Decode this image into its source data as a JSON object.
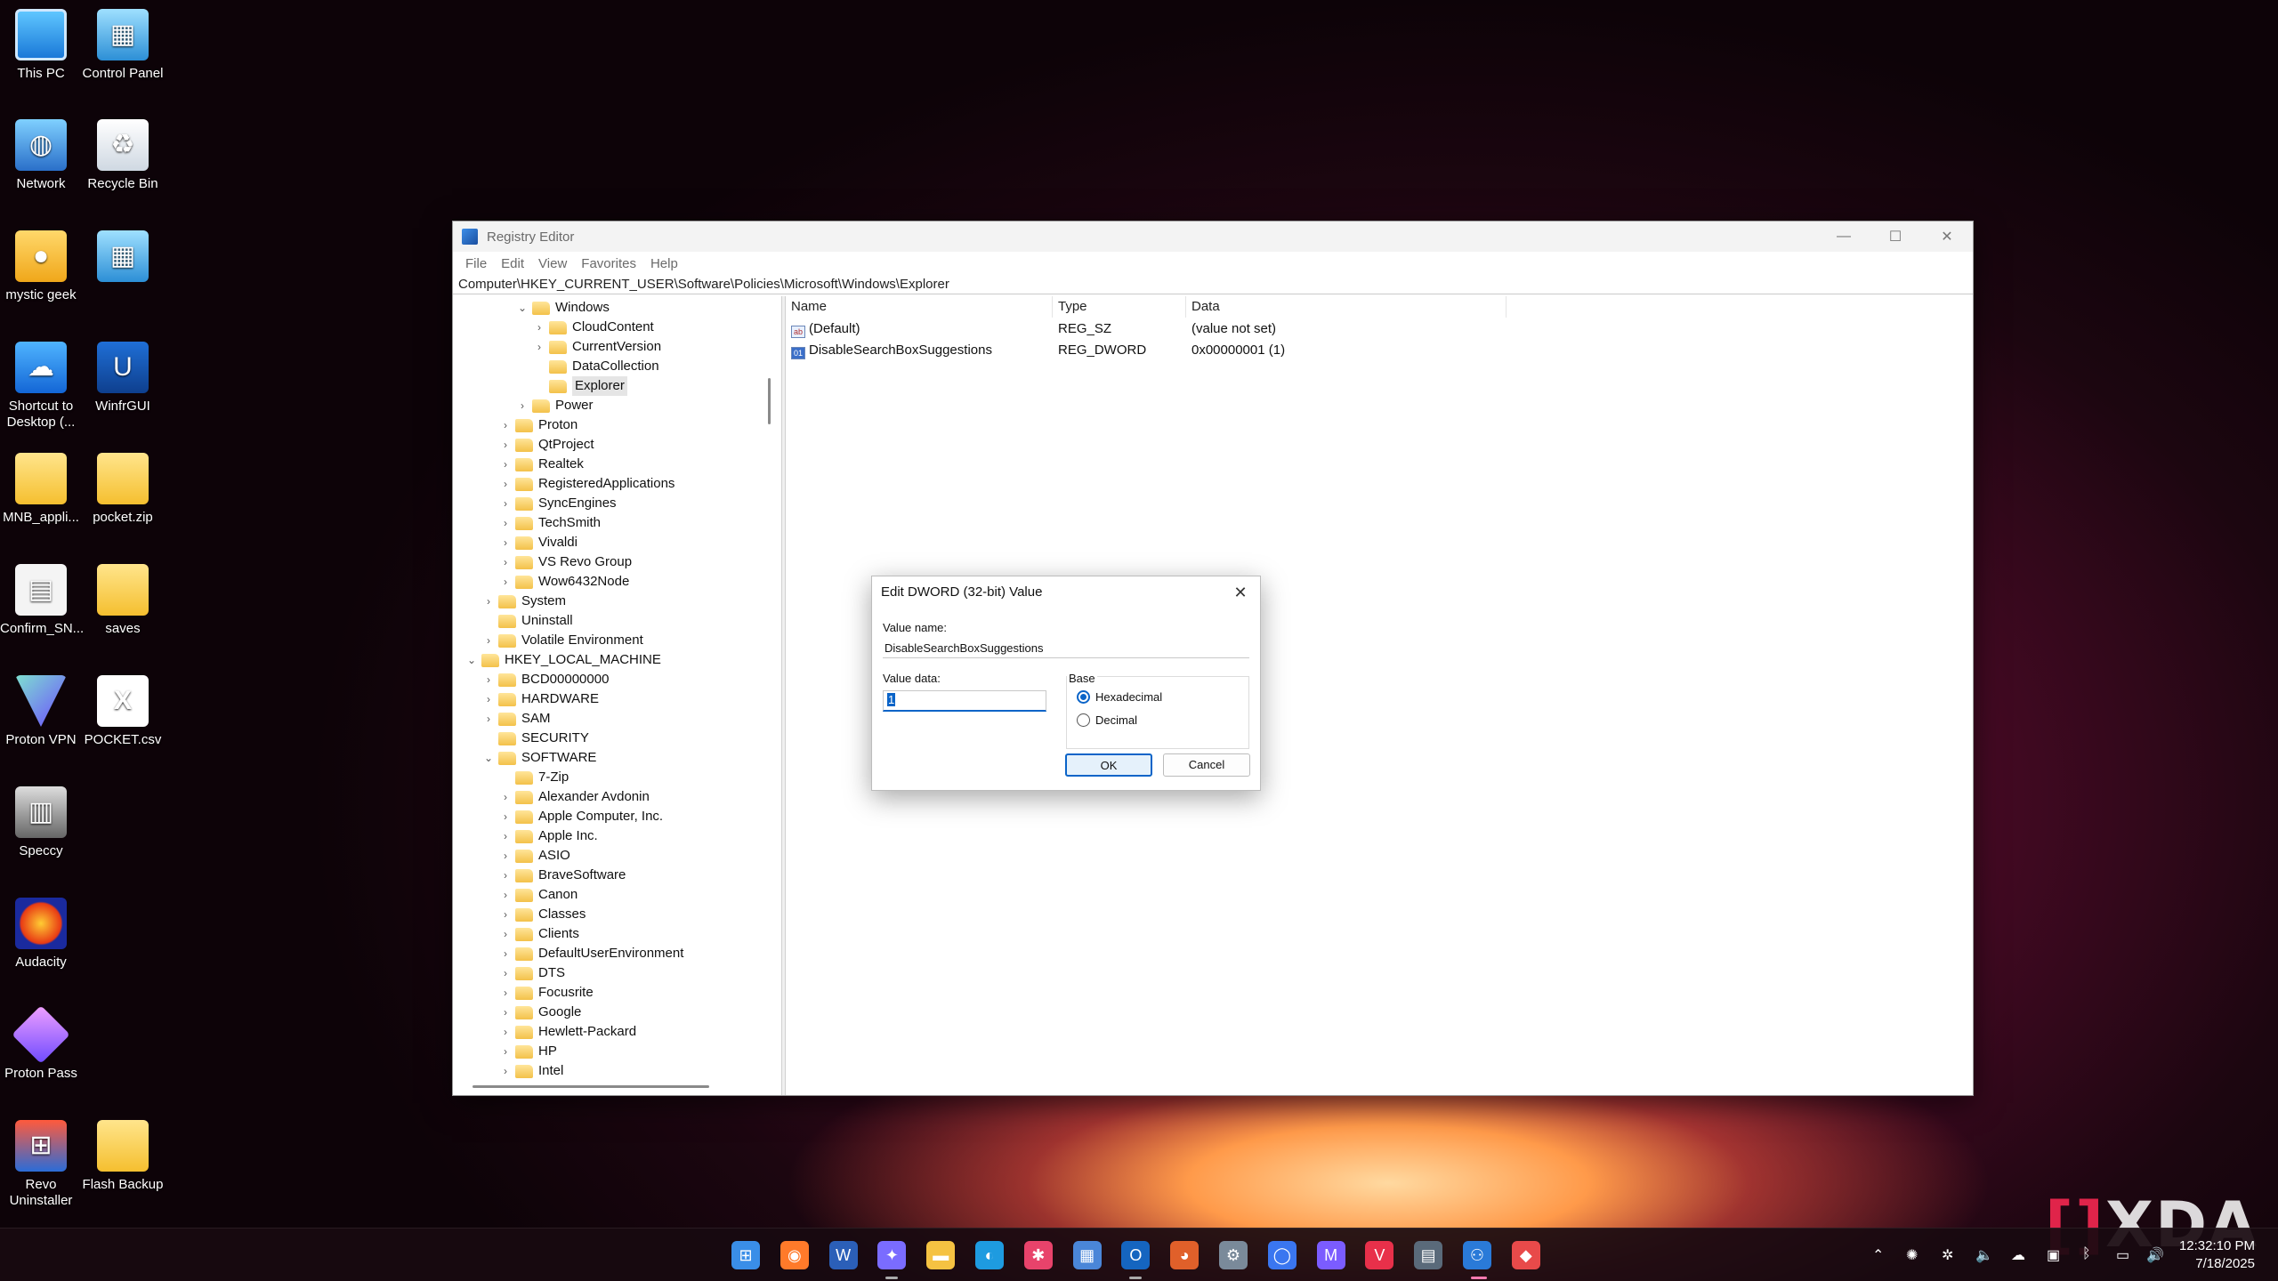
{
  "desktop": {
    "icons": [
      {
        "label": "This PC",
        "icon": "this-pc-icon"
      },
      {
        "label": "Control Panel",
        "icon": "control-panel-icon"
      },
      {
        "label": "Network",
        "icon": "network-icon"
      },
      {
        "label": "Recycle Bin",
        "icon": "recycle-bin-icon"
      },
      {
        "label": "mystic geek",
        "icon": "user-folder-icon"
      },
      {
        "label": "",
        "icon": "control-panel-icon"
      },
      {
        "label": "Shortcut to Desktop (...",
        "icon": "onedrive-icon"
      },
      {
        "label": "WinfrGUI",
        "icon": "winfrgui-icon"
      },
      {
        "label": "MNB_appli...",
        "icon": "zip-folder-icon"
      },
      {
        "label": "pocket.zip",
        "icon": "zip-folder-icon"
      },
      {
        "label": "Confirm_SN...",
        "icon": "document-icon"
      },
      {
        "label": "saves",
        "icon": "folder-icon"
      },
      {
        "label": "Proton VPN",
        "icon": "proton-vpn-icon"
      },
      {
        "label": "POCKET.csv",
        "icon": "excel-icon"
      },
      {
        "label": "Speccy",
        "icon": "speccy-icon"
      },
      {
        "label": "Audacity",
        "icon": "audacity-icon"
      },
      {
        "label": "Proton Pass",
        "icon": "proton-pass-icon"
      },
      {
        "label": "Revo Uninstaller",
        "icon": "revo-uninstaller-icon"
      },
      {
        "label": "Flash Backup",
        "icon": "folder-icon"
      }
    ]
  },
  "regedit": {
    "title": "Registry Editor",
    "menu": [
      "File",
      "Edit",
      "View",
      "Favorites",
      "Help"
    ],
    "address": "Computer\\HKEY_CURRENT_USER\\Software\\Policies\\Microsoft\\Windows\\Explorer",
    "tree": [
      {
        "label": "Windows",
        "expanded": true
      },
      {
        "label": "CloudContent",
        "expanded": false
      },
      {
        "label": "CurrentVersion",
        "expanded": false
      },
      {
        "label": "DataCollection",
        "expanded": false
      },
      {
        "label": "Explorer",
        "selected": true
      },
      {
        "label": "Power",
        "expanded": false
      },
      {
        "label": "Proton"
      },
      {
        "label": "QtProject"
      },
      {
        "label": "Realtek"
      },
      {
        "label": "RegisteredApplications"
      },
      {
        "label": "SyncEngines"
      },
      {
        "label": "TechSmith"
      },
      {
        "label": "Vivaldi"
      },
      {
        "label": "VS Revo Group"
      },
      {
        "label": "Wow6432Node"
      },
      {
        "label": "System"
      },
      {
        "label": "Uninstall"
      },
      {
        "label": "Volatile Environment"
      },
      {
        "label": "HKEY_LOCAL_MACHINE",
        "expanded": true
      },
      {
        "label": "BCD00000000"
      },
      {
        "label": "HARDWARE"
      },
      {
        "label": "SAM"
      },
      {
        "label": "SECURITY"
      },
      {
        "label": "SOFTWARE",
        "expanded": true
      },
      {
        "label": "7-Zip"
      },
      {
        "label": "Alexander Avdonin"
      },
      {
        "label": "Apple Computer, Inc."
      },
      {
        "label": "Apple Inc."
      },
      {
        "label": "ASIO"
      },
      {
        "label": "BraveSoftware"
      },
      {
        "label": "Canon"
      },
      {
        "label": "Classes"
      },
      {
        "label": "Clients"
      },
      {
        "label": "DefaultUserEnvironment"
      },
      {
        "label": "DTS"
      },
      {
        "label": "Focusrite"
      },
      {
        "label": "Google"
      },
      {
        "label": "Hewlett-Packard"
      },
      {
        "label": "HP"
      },
      {
        "label": "Intel"
      }
    ],
    "columns": [
      "Name",
      "Type",
      "Data"
    ],
    "values": [
      {
        "name": "(Default)",
        "type": "REG_SZ",
        "data": "(value not set)",
        "icon": "string-value-icon"
      },
      {
        "name": "DisableSearchBoxSuggestions",
        "type": "REG_DWORD",
        "data": "0x00000001 (1)",
        "icon": "binary-value-icon"
      }
    ]
  },
  "dialog": {
    "title": "Edit DWORD (32-bit) Value",
    "value_name_label": "Value name:",
    "value_name": "DisableSearchBoxSuggestions",
    "value_data_label": "Value data:",
    "value_data": "1",
    "base_label": "Base",
    "radio_hex": "Hexadecimal",
    "radio_dec": "Decimal",
    "ok": "OK",
    "cancel": "Cancel"
  },
  "taskbar": {
    "apps": [
      "start-icon",
      "firefox-icon",
      "word-icon",
      "copilot-icon",
      "file-explorer-icon",
      "edge-icon",
      "slack-icon",
      "store-icon",
      "outlook-icon",
      "duckduckgo-icon",
      "settings-icon",
      "signal-icon",
      "proton-mail-icon",
      "vivaldi-icon",
      "calculator-icon",
      "regedit-icon",
      "photos-icon"
    ],
    "time": "12:32:10 PM",
    "date": "7/18/2025"
  },
  "watermark": "XDA"
}
